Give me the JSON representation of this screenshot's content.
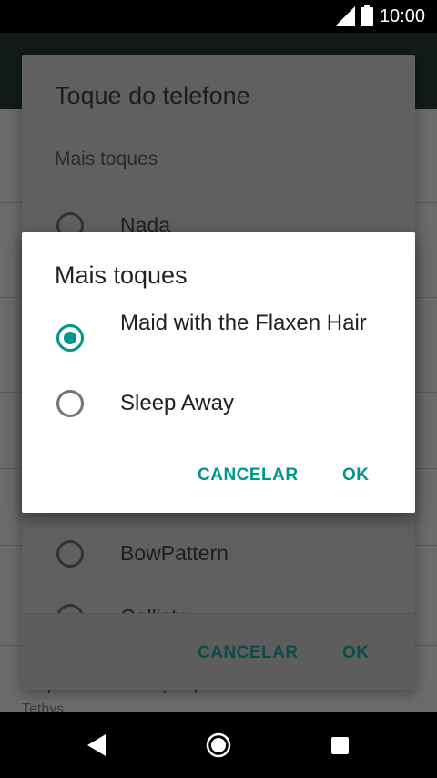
{
  "status_bar": {
    "time": "10:00"
  },
  "background": {
    "settings_item_title": "Toque de notificação predefinido",
    "settings_item_value": "Tethys"
  },
  "ringtone_dialog": {
    "title": "Toque do telefone",
    "section": "Mais toques",
    "options": [
      "Nada",
      "BowPattern",
      "Callisto"
    ],
    "cancel_label": "CANCELAR",
    "ok_label": "OK"
  },
  "more_ringtones_dialog": {
    "title": "Mais toques",
    "options": [
      {
        "label": "Maid with the Flaxen Hair",
        "selected": true
      },
      {
        "label": "Sleep Away",
        "selected": false
      }
    ],
    "cancel_label": "CANCELAR",
    "ok_label": "OK"
  },
  "colors": {
    "accent": "#009688",
    "scrim": "#5f5f5f"
  }
}
